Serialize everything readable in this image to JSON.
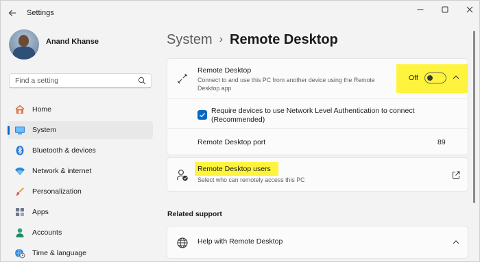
{
  "window": {
    "title": "Settings"
  },
  "profile": {
    "name": "Anand Khanse"
  },
  "search": {
    "placeholder": "Find a setting",
    "icon": "search-icon"
  },
  "sidebar": {
    "items": [
      {
        "label": "Home",
        "icon": "home-icon",
        "active": false
      },
      {
        "label": "System",
        "icon": "monitor-icon",
        "active": true
      },
      {
        "label": "Bluetooth & devices",
        "icon": "bluetooth-icon",
        "active": false
      },
      {
        "label": "Network & internet",
        "icon": "wifi-icon",
        "active": false
      },
      {
        "label": "Personalization",
        "icon": "brush-icon",
        "active": false
      },
      {
        "label": "Apps",
        "icon": "apps-icon",
        "active": false
      },
      {
        "label": "Accounts",
        "icon": "person-icon",
        "active": false
      },
      {
        "label": "Time & language",
        "icon": "globe-clock-icon",
        "active": false
      }
    ]
  },
  "breadcrumb": {
    "parent": "System",
    "separator": "›",
    "current": "Remote Desktop"
  },
  "remote_desktop": {
    "title": "Remote Desktop",
    "description": "Connect to and use this PC from another device using the Remote Desktop app",
    "toggle_label": "Off",
    "toggle_on": false,
    "nla_checkbox_label": "Require devices to use Network Level Authentication to connect (Recommended)",
    "nla_checked": true,
    "port_label": "Remote Desktop port",
    "port_value": "89"
  },
  "remote_users": {
    "title": "Remote Desktop users",
    "description": "Select who can remotely access this PC"
  },
  "related": {
    "section_title": "Related support",
    "help_title": "Help with Remote Desktop"
  },
  "colors": {
    "accent": "#0a66c2",
    "highlight": "#fff43d",
    "background": "#f3f3f3",
    "card": "#fbfbfb"
  }
}
